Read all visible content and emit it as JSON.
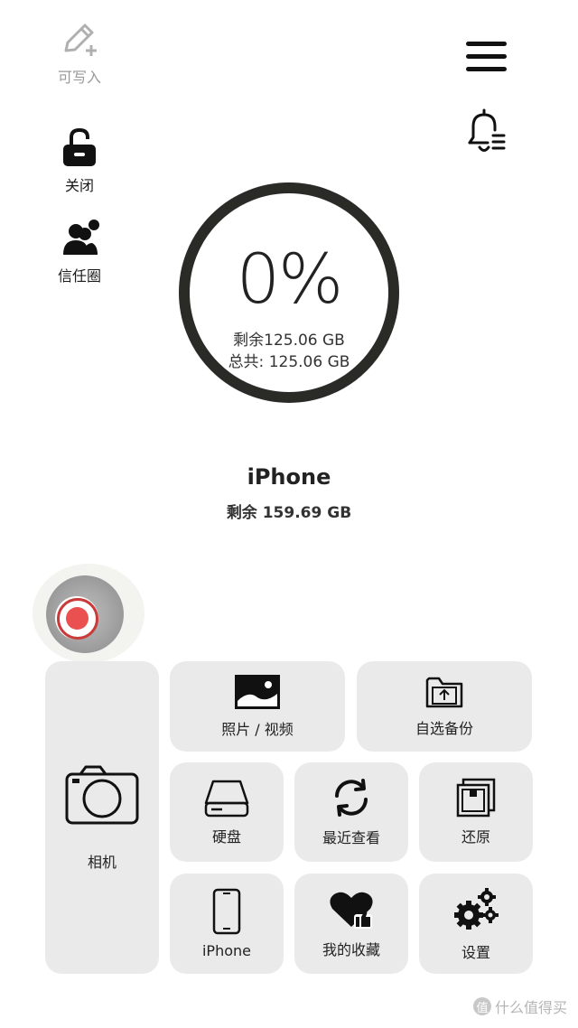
{
  "side_menu": {
    "writable_label": "可写入",
    "lock_label": "关闭",
    "trust_circle_label": "信任圈"
  },
  "icons": {
    "writable": "pencil-plus-icon",
    "lock": "unlock-icon",
    "trust_circle": "people-icon",
    "menu": "hamburger-icon",
    "notifications": "bell-list-icon"
  },
  "storage": {
    "percent": "0%",
    "remaining": "剩余125.06 GB",
    "total": "总共: 125.06 GB"
  },
  "device": {
    "name": "iPhone",
    "free": "剩余 159.69 GB"
  },
  "tiles": {
    "camera": "相机",
    "photos_videos": "照片 / 视频",
    "custom_backup": "自选备份",
    "drive": "硬盘",
    "recent": "最近查看",
    "restore": "还原",
    "iphone": "iPhone",
    "favorites": "我的收藏",
    "settings": "设置"
  },
  "watermark": {
    "badge": "值",
    "text": "什么值得买"
  },
  "colors": {
    "ring": "#2a2a26",
    "tile_bg": "#ebeaea",
    "record_red": "#ea5050"
  }
}
